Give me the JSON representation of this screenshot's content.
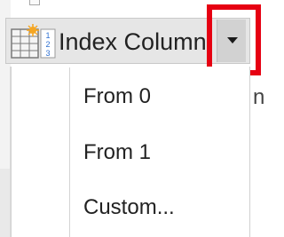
{
  "ribbon": {
    "button_label": "Index Column",
    "icon": "index-column-icon",
    "dropdown_icon": "dropdown-arrow-icon"
  },
  "menu": {
    "items": [
      {
        "label": "From 0"
      },
      {
        "label": "From 1"
      },
      {
        "label": "Custom..."
      }
    ]
  },
  "background": {
    "partial_text": "n"
  },
  "colors": {
    "highlight": "#e60012",
    "ribbon_bg": "#e6e6e6",
    "dropdown_bg": "#d2d2d2",
    "text": "#222222",
    "icon_accent": "#f5a623",
    "icon_number": "#2e6fd1"
  }
}
